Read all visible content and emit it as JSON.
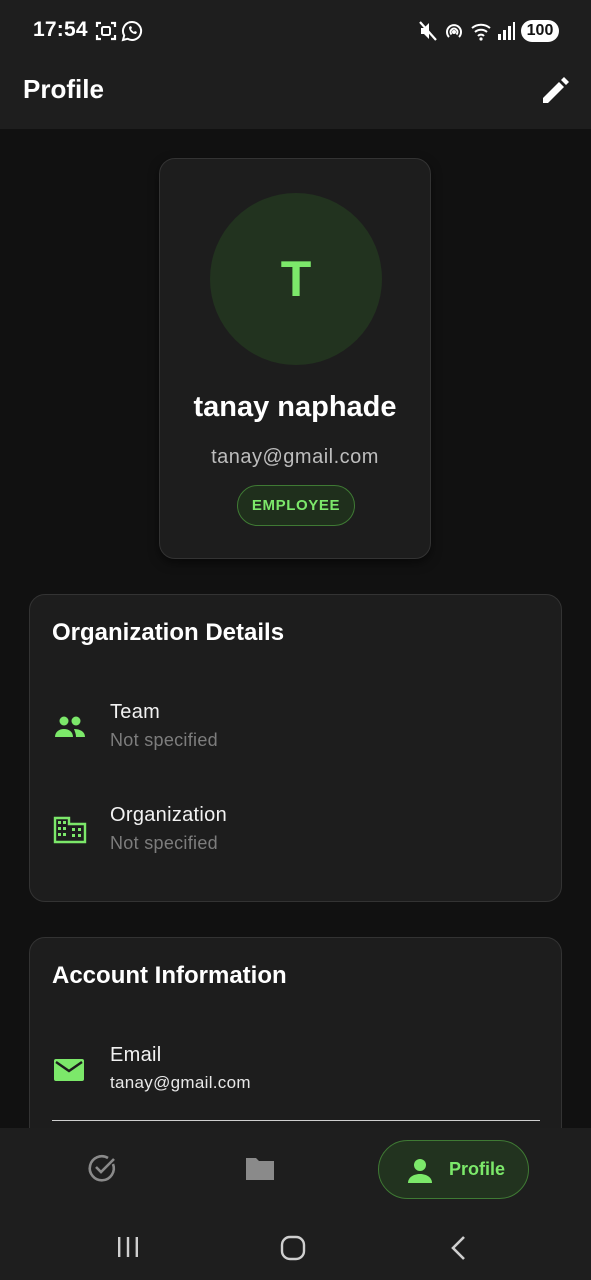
{
  "status_bar": {
    "time": "17:54",
    "battery": "100",
    "icons": [
      "screenshot-icon",
      "whatsapp-icon",
      "mute-icon",
      "hotspot-icon",
      "wifi-icon",
      "signal-icon"
    ]
  },
  "app_bar": {
    "title": "Profile",
    "action_icon": "edit-icon"
  },
  "profile": {
    "avatar_initial": "T",
    "name": "tanay naphade",
    "email": "tanay@gmail.com",
    "role": "EMPLOYEE"
  },
  "organization": {
    "title": "Organization Details",
    "rows": [
      {
        "icon": "group-icon",
        "label": "Team",
        "value": "Not specified"
      },
      {
        "icon": "building-icon",
        "label": "Organization",
        "value": "Not specified"
      }
    ]
  },
  "account": {
    "title": "Account Information",
    "rows": [
      {
        "icon": "mail-icon",
        "label": "Email",
        "value": "tanay@gmail.com"
      }
    ]
  },
  "bottom_nav": {
    "items": [
      {
        "icon": "check-circle-icon",
        "label": ""
      },
      {
        "icon": "folder-icon",
        "label": ""
      },
      {
        "icon": "person-icon",
        "label": "Profile",
        "active": true
      }
    ]
  },
  "colors": {
    "accent": "#7ce86a",
    "surface": "#1d1d1d",
    "background": "#111111"
  }
}
